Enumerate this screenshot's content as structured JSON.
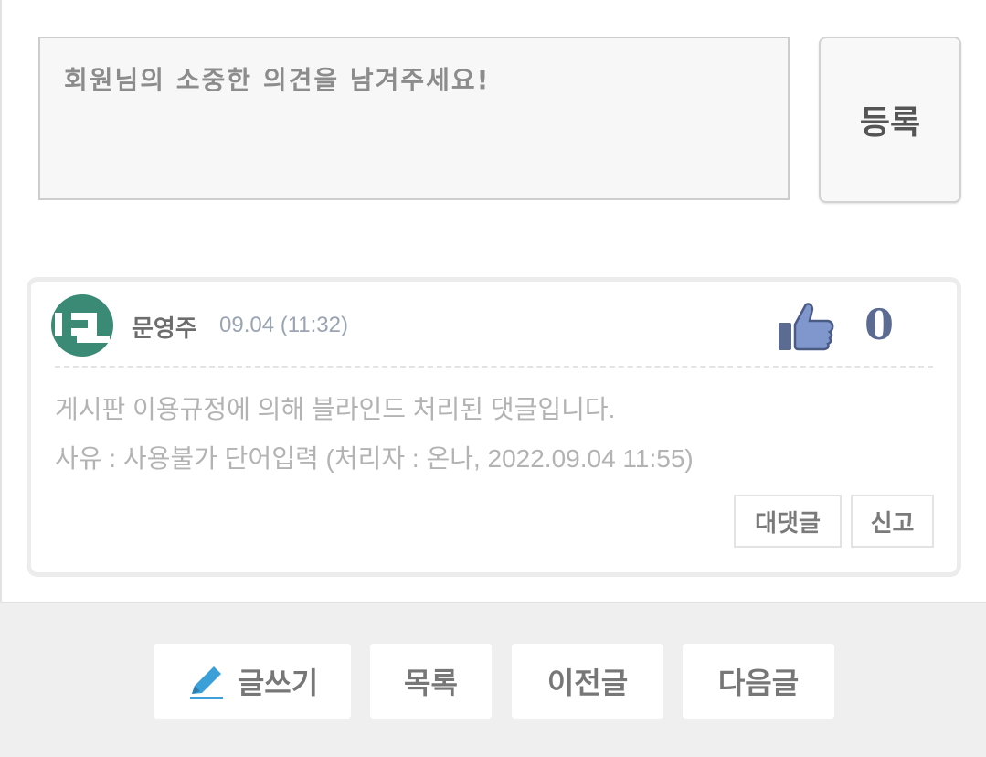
{
  "comment_form": {
    "placeholder": "회원님의 소중한 의견을 남겨주세요!",
    "value": "",
    "submit_label": "등록"
  },
  "comment": {
    "author": "문영주",
    "date": "09.04 (11:32)",
    "like_count": "0",
    "body_line1": "게시판 이용규정에 의해 블라인드 처리된 댓글입니다.",
    "body_line2": "사유 : 사용불가 단어입력 (처리자 : 온나, 2022.09.04 11:55)",
    "reply_label": "대댓글",
    "report_label": "신고",
    "avatar_color": "#3a8a75",
    "like_icon": "thumbs-up-icon"
  },
  "bottom_nav": {
    "write_label": "글쓰기",
    "write_icon": "pencil-icon",
    "list_label": "목록",
    "prev_label": "이전글",
    "next_label": "다음글"
  },
  "colors": {
    "pencil": "#3b9fd8",
    "like_blue": "#5b6b91"
  }
}
